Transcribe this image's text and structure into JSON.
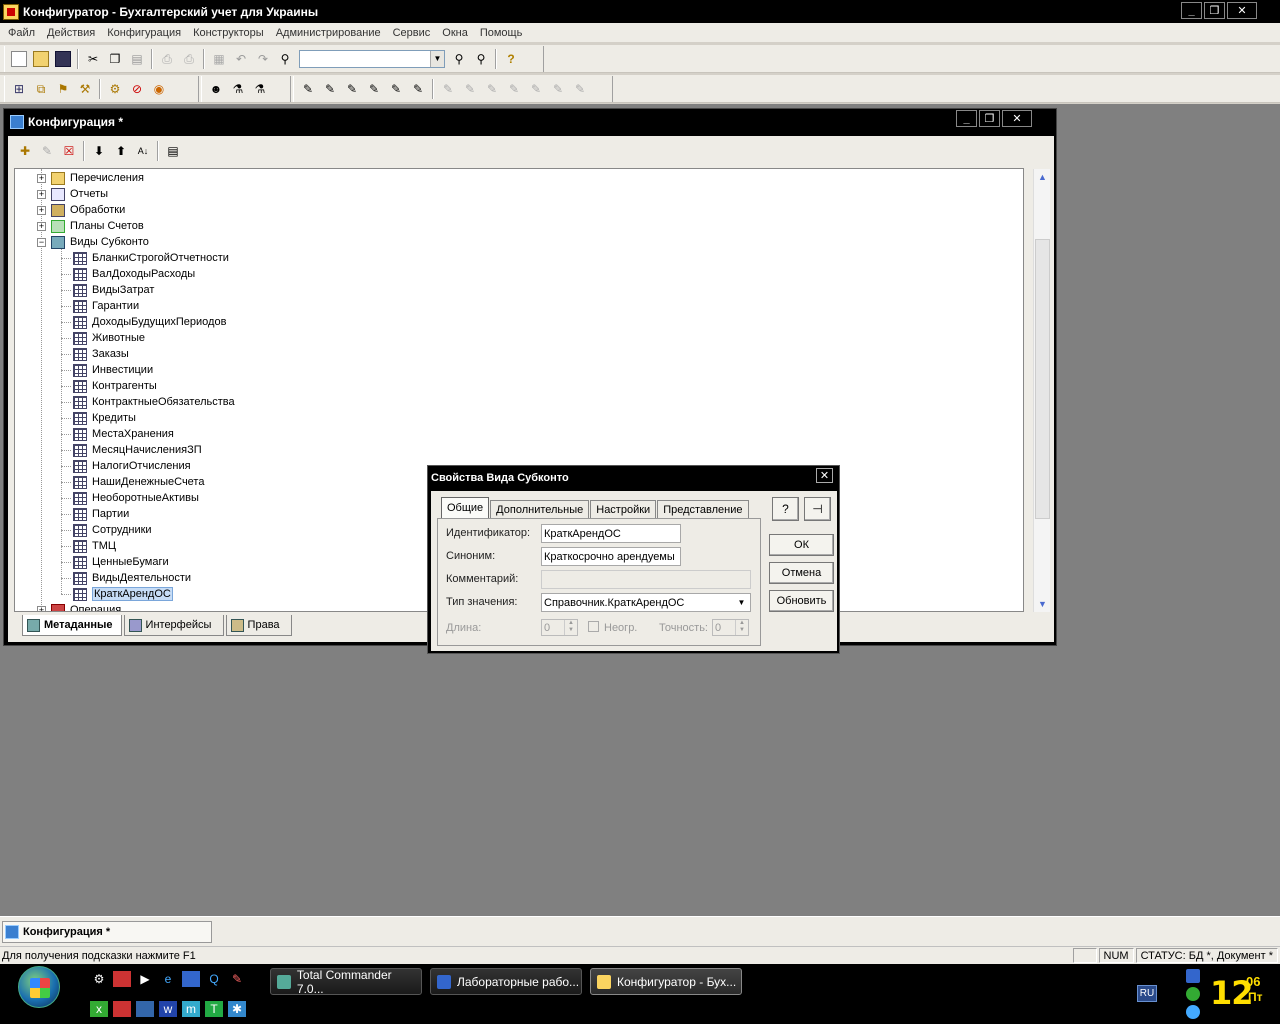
{
  "app": {
    "title": "Конфигуратор - Бухгалтерский учет для Украины",
    "window_buttons": [
      "_",
      "❐",
      "✕"
    ]
  },
  "menu": [
    "Файл",
    "Действия",
    "Конфигурация",
    "Конструкторы",
    "Администрирование",
    "Сервис",
    "Окна",
    "Помощь"
  ],
  "toolbar": {
    "search_value": "",
    "help_glyph": "?"
  },
  "config_window": {
    "title": "Конфигурация *",
    "buttons": [
      "_",
      "❐",
      "✕"
    ],
    "tree": [
      {
        "label": "Перечисления",
        "level": 0,
        "expander": "+",
        "icon": "enum-icon"
      },
      {
        "label": "Отчеты",
        "level": 0,
        "expander": "+",
        "icon": "report-icon"
      },
      {
        "label": "Обработки",
        "level": 0,
        "expander": "+",
        "icon": "processing-icon"
      },
      {
        "label": "Планы Счетов",
        "level": 0,
        "expander": "+",
        "icon": "chart-of-accounts-icon"
      },
      {
        "label": "Виды Субконто",
        "level": 0,
        "expander": "−",
        "icon": "subconto-kinds-icon"
      },
      {
        "label": "БланкиСтрогойОтчетности",
        "level": 1,
        "icon": "subconto-icon"
      },
      {
        "label": "ВалДоходыРасходы",
        "level": 1,
        "icon": "subconto-icon"
      },
      {
        "label": "ВидыЗатрат",
        "level": 1,
        "icon": "subconto-icon"
      },
      {
        "label": "Гарантии",
        "level": 1,
        "icon": "subconto-icon"
      },
      {
        "label": "ДоходыБудущихПериодов",
        "level": 1,
        "icon": "subconto-icon"
      },
      {
        "label": "Животные",
        "level": 1,
        "icon": "subconto-icon"
      },
      {
        "label": "Заказы",
        "level": 1,
        "icon": "subconto-icon"
      },
      {
        "label": "Инвестиции",
        "level": 1,
        "icon": "subconto-icon"
      },
      {
        "label": "Контрагенты",
        "level": 1,
        "icon": "subconto-icon"
      },
      {
        "label": "КонтрактныеОбязательства",
        "level": 1,
        "icon": "subconto-icon"
      },
      {
        "label": "Кредиты",
        "level": 1,
        "icon": "subconto-icon"
      },
      {
        "label": "МестаХранения",
        "level": 1,
        "icon": "subconto-icon"
      },
      {
        "label": "МесяцНачисленияЗП",
        "level": 1,
        "icon": "subconto-icon"
      },
      {
        "label": "НалогиОтчисления",
        "level": 1,
        "icon": "subconto-icon"
      },
      {
        "label": "НашиДенежныеСчета",
        "level": 1,
        "icon": "subconto-icon"
      },
      {
        "label": "НеоборотныеАктивы",
        "level": 1,
        "icon": "subconto-icon"
      },
      {
        "label": "Партии",
        "level": 1,
        "icon": "subconto-icon"
      },
      {
        "label": "Сотрудники",
        "level": 1,
        "icon": "subconto-icon"
      },
      {
        "label": "ТМЦ",
        "level": 1,
        "icon": "subconto-icon"
      },
      {
        "label": "ЦенныеБумаги",
        "level": 1,
        "icon": "subconto-icon"
      },
      {
        "label": "ВидыДеятельности",
        "level": 1,
        "icon": "subconto-icon"
      },
      {
        "label": "КраткАрендОС",
        "level": 1,
        "icon": "subconto-icon",
        "selected": true
      },
      {
        "label": "Операция",
        "level": 0,
        "expander": "+",
        "icon": "operation-icon"
      }
    ],
    "tabs": [
      "Метаданные",
      "Интерфейсы",
      "Права"
    ],
    "active_tab": "Метаданные"
  },
  "dialog": {
    "title": "Свойства Вида Субконто",
    "close": "✕",
    "tabs": [
      "Общие",
      "Дополнительные",
      "Настройки",
      "Представление"
    ],
    "active_tab": "Общие",
    "fields": {
      "identifier_label": "Идентификатор:",
      "identifier_value": "КраткАрендОС",
      "synonym_label": "Синоним:",
      "synonym_value": "Краткосрочно арендуемы",
      "comment_label": "Комментарий:",
      "comment_value": "",
      "type_label": "Тип значения:",
      "type_value": "Справочник.КраткАрендОС",
      "length_label": "Длина:",
      "length_value": "0",
      "nonneg_label": "Неогр.",
      "precision_label": "Точность:",
      "precision_value": "0"
    },
    "buttons": {
      "help": "?",
      "pin": "⊣",
      "ok": "ОК",
      "cancel": "Отмена",
      "refresh": "Обновить"
    }
  },
  "window_bar": {
    "minimized_title": "Конфигурация *"
  },
  "status": {
    "message": "Для получения подсказки нажмите F1",
    "num": "NUM",
    "state": "СТАТУС: БД *, Документ *"
  },
  "taskbar": {
    "tasks": [
      "Total Commander 7.0...",
      "Лабораторные рабо...",
      "Конфигуратор - Бух..."
    ],
    "active_task": 2,
    "lang": "RU",
    "clock_hour": "12",
    "clock_min": "06",
    "clock_day": "Пт"
  },
  "colors": {
    "selection": "#c6dcf6",
    "clock": "#ffde00",
    "mdi_bg": "#808080"
  }
}
